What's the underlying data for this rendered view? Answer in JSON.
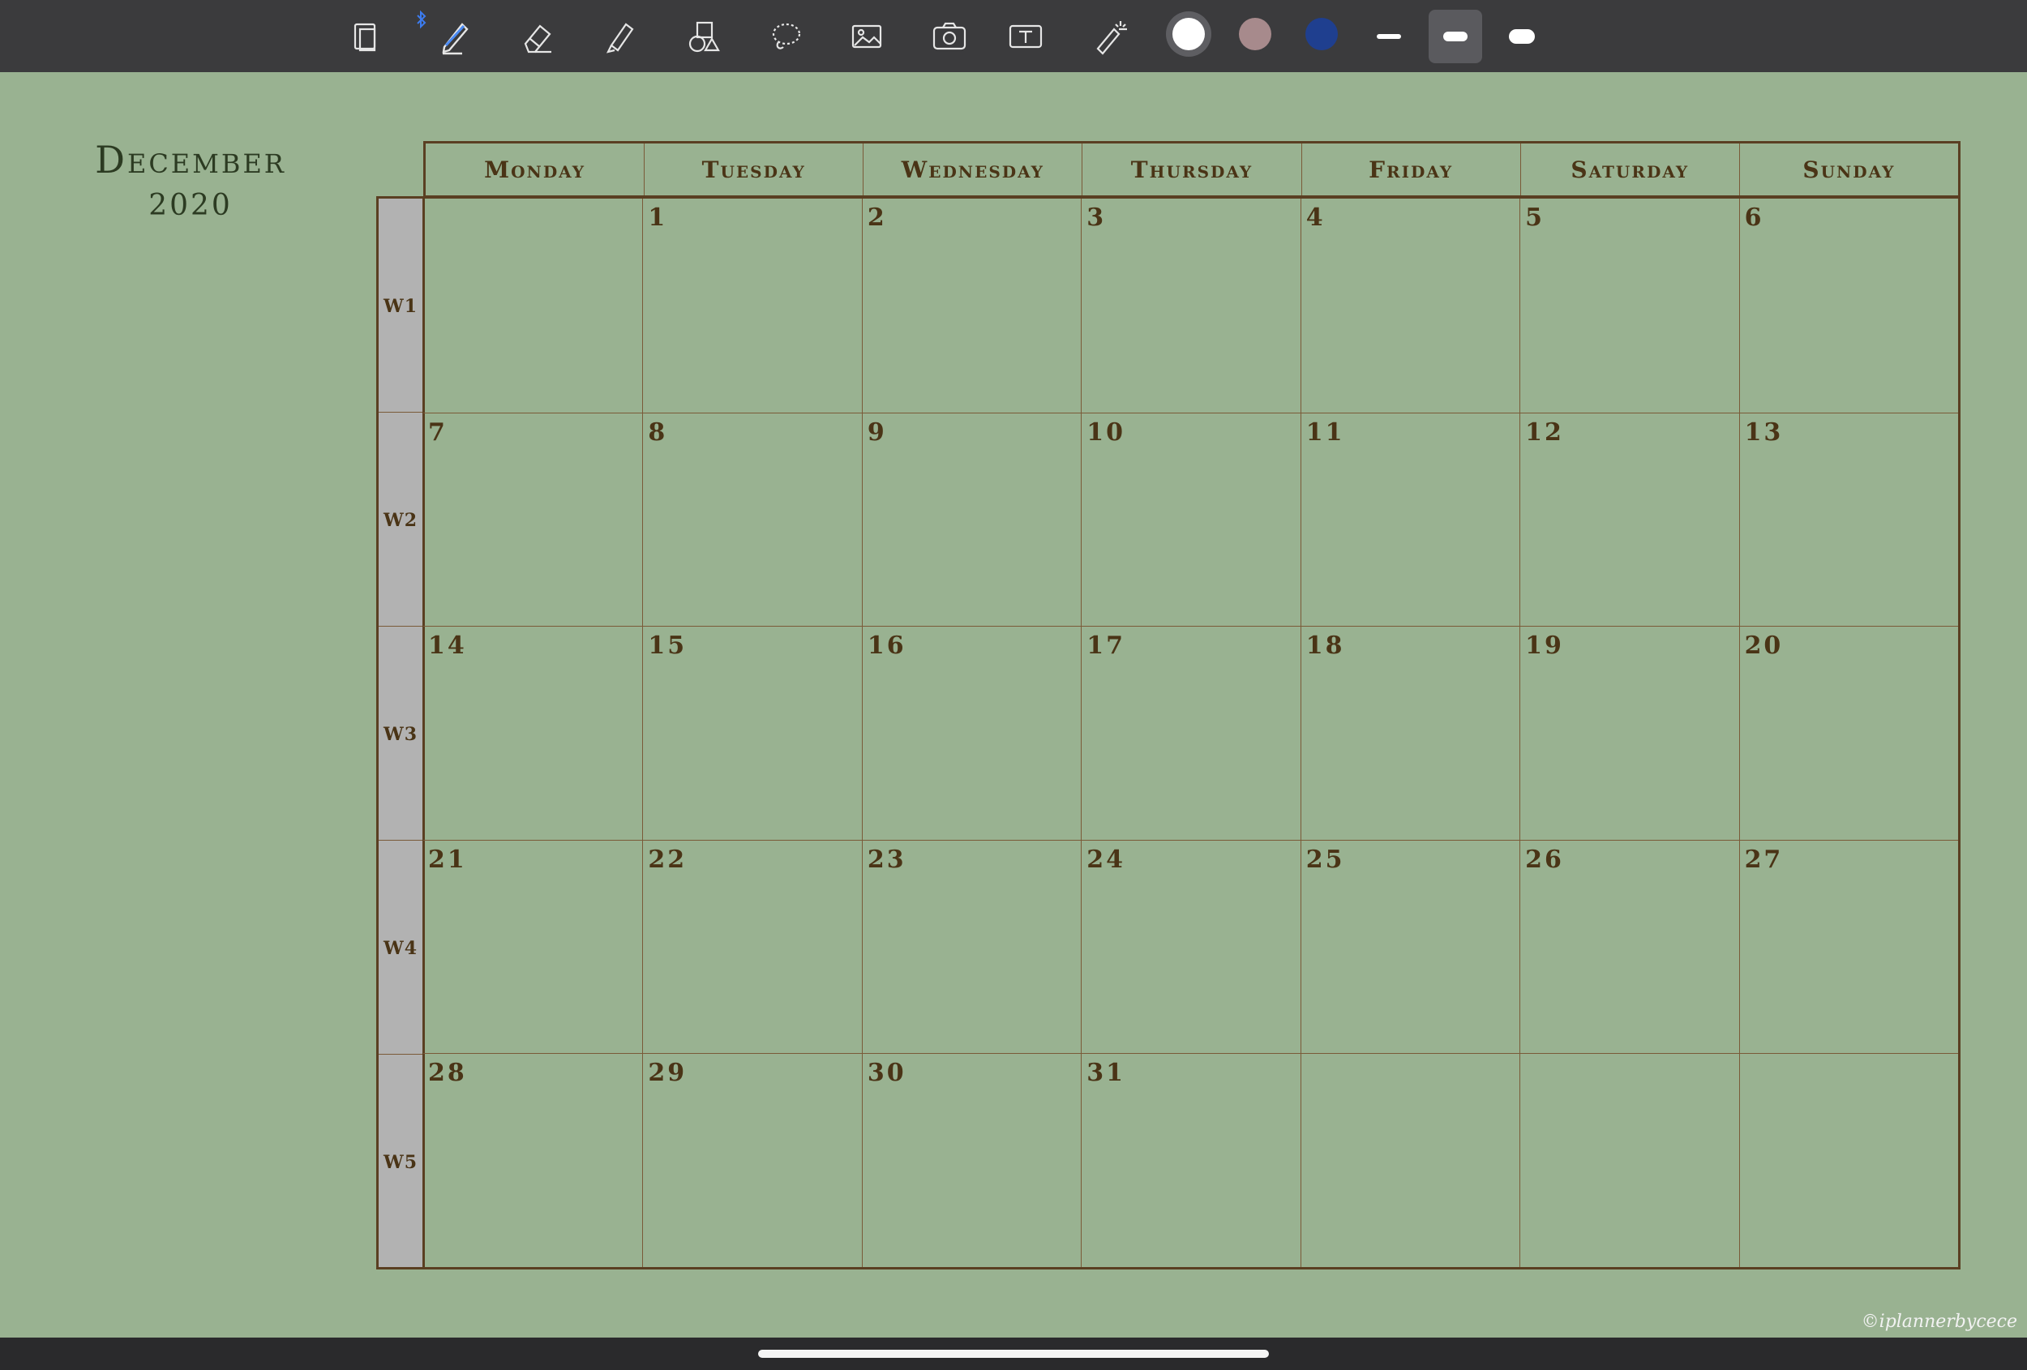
{
  "toolbar": {
    "tools": [
      {
        "name": "pages-icon"
      },
      {
        "name": "pen-icon"
      },
      {
        "name": "eraser-icon"
      },
      {
        "name": "highlighter-icon"
      },
      {
        "name": "shapes-icon"
      },
      {
        "name": "lasso-icon"
      },
      {
        "name": "image-icon"
      },
      {
        "name": "camera-icon"
      },
      {
        "name": "text-icon"
      },
      {
        "name": "laser-pointer-icon"
      }
    ],
    "colors": [
      "#ffffff",
      "#a78a8c",
      "#1f3f8f"
    ],
    "sizes": [
      "thin",
      "medium",
      "thick"
    ],
    "selected_size": "medium"
  },
  "calendar": {
    "month": "December",
    "year": "2020",
    "days": [
      "Monday",
      "Tuesday",
      "Wednesday",
      "Thursday",
      "Friday",
      "Saturday",
      "Sunday"
    ],
    "weeks": [
      "W1",
      "W2",
      "W3",
      "W4",
      "W5"
    ],
    "dates": [
      [
        "",
        "1",
        "2",
        "3",
        "4",
        "5",
        "6"
      ],
      [
        "7",
        "8",
        "9",
        "10",
        "11",
        "12",
        "13"
      ],
      [
        "14",
        "15",
        "16",
        "17",
        "18",
        "19",
        "20"
      ],
      [
        "21",
        "22",
        "23",
        "24",
        "25",
        "26",
        "27"
      ],
      [
        "28",
        "29",
        "30",
        "31",
        "",
        "",
        ""
      ]
    ]
  },
  "watermark": "©iplannerbycece",
  "colors": {
    "background": "#99b291",
    "toolbar": "#3b3b3d",
    "border": "#5a3f22",
    "week_column": "#b2b2b2"
  }
}
